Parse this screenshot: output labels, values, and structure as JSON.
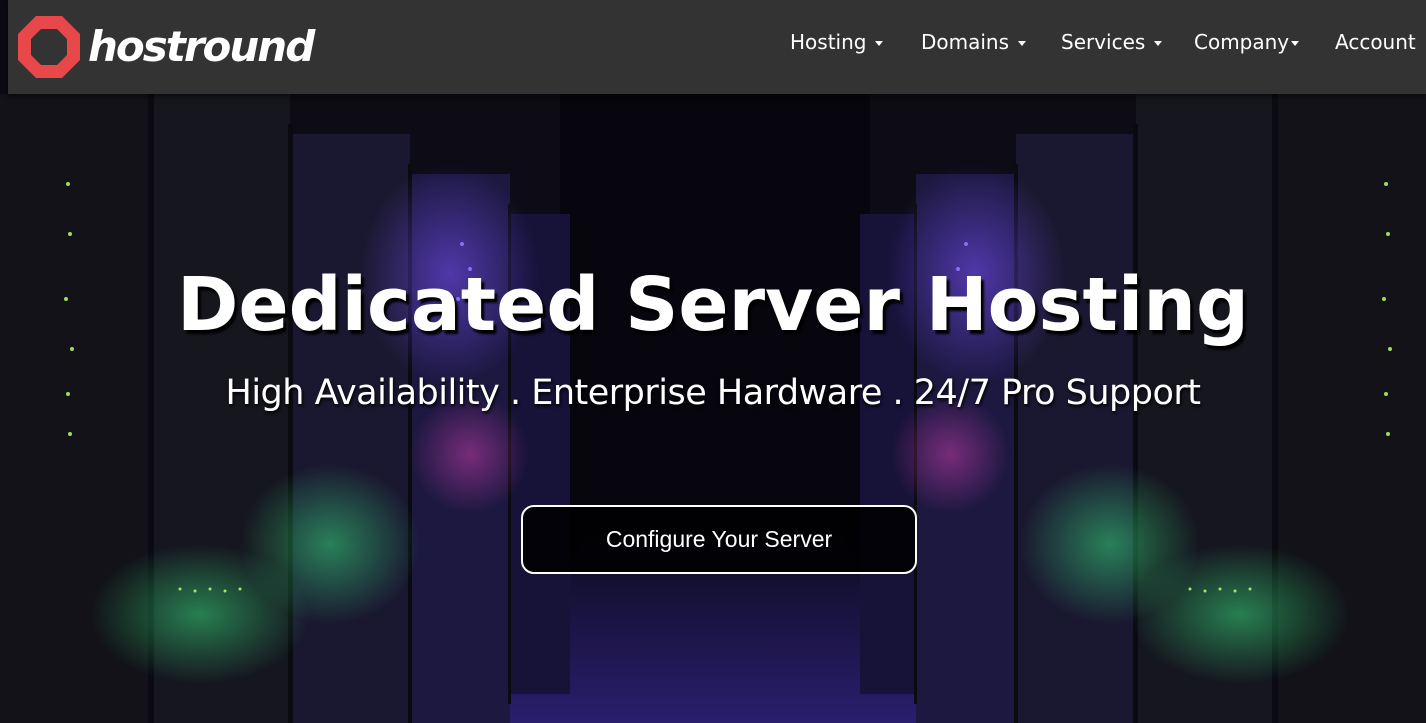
{
  "brand": {
    "name": "hostround",
    "logo_color": "#e8484a"
  },
  "nav": {
    "items": [
      {
        "label": "Hosting",
        "has_dropdown": true
      },
      {
        "label": "Domains",
        "has_dropdown": true
      },
      {
        "label": "Services",
        "has_dropdown": true
      },
      {
        "label": "Company",
        "has_dropdown": true
      },
      {
        "label": "Account",
        "has_dropdown": false
      }
    ]
  },
  "hero": {
    "title": "Dedicated Server Hosting",
    "subtitle": "High Availability . Enterprise Hardware . 24/7 Pro Support",
    "cta_label": "Configure Your Server",
    "background_icon": "server-room-image"
  },
  "colors": {
    "header_bg": "#333333",
    "accent": "#e8484a",
    "hero_bg": "#0b0a14"
  }
}
